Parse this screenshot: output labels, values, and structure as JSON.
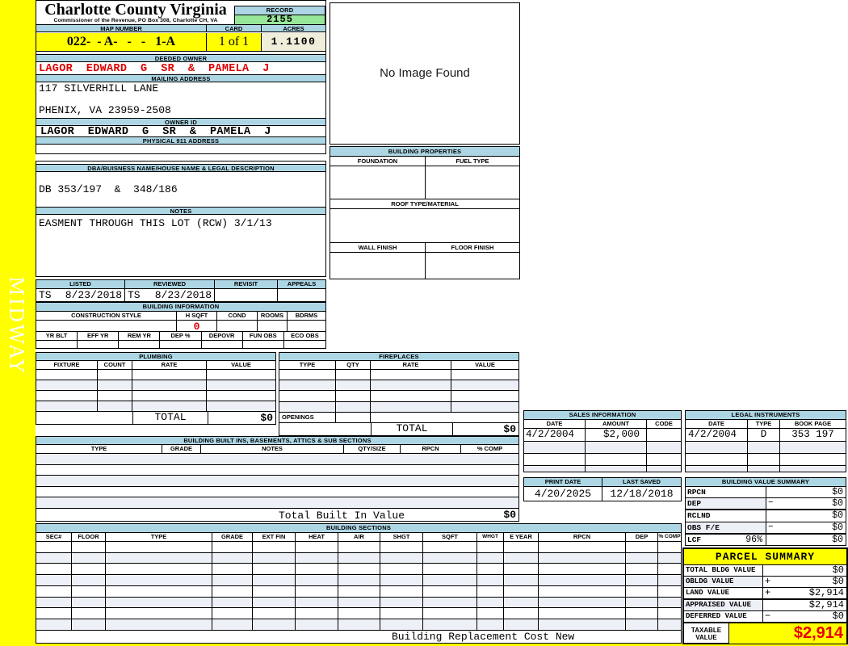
{
  "watermark": "MIDWAY",
  "colors": {
    "band_blue": "#ADD6E4",
    "record_green": "#98E798",
    "accent_yellow": "#FFFF00",
    "acres_cream": "#F0EDDB",
    "alert_red": "#DE0000"
  },
  "header": {
    "county": "Charlotte County Virginia",
    "commissioner": "Commissioner of the Revenue, PO Box 308, Charlotte CH, VA",
    "record_label": "RECORD",
    "record_value": "2155",
    "map_label": "MAP NUMBER",
    "map_value": "022-  - A-   -   -   1-A",
    "card_label": "CARD",
    "card_value": "1 of 1",
    "acres_label": "ACRES",
    "acres_value": "1.1100"
  },
  "owner": {
    "deeded_label": "DEEDED OWNER",
    "deeded_value": "LAGOR  EDWARD  G  SR  &  PAMELA  J",
    "mailing_label": "MAILING ADDRESS",
    "address_line1": "117 SILVERHILL LANE",
    "address_line2": "PHENIX, VA 23959-2508",
    "owner_id_label": "OWNER ID",
    "owner_id_value": "LAGOR  EDWARD  G  SR  &  PAMELA  J",
    "physical_label": "PHYSICAL 911 ADDRESS"
  },
  "photo": {
    "placeholder": "No Image Found"
  },
  "properties": {
    "title": "BUILDING PROPERTIES",
    "foundation_label": "FOUNDATION",
    "fuel_label": "FUEL TYPE",
    "roof_label": "ROOF TYPE/MATERIAL",
    "wall_label": "WALL FINISH",
    "floor_label": "FLOOR FINISH"
  },
  "dba": {
    "label": "DBA/BUISNESS NAME/HOUSE NAME & LEGAL DESCRIPTION",
    "value": "DB 353/197  &  348/186"
  },
  "notes": {
    "label": "NOTES",
    "value": "EASMENT THROUGH THIS LOT (RCW) 3/1/13"
  },
  "review": {
    "columns": [
      "LISTED",
      "REVIEWED",
      "REVISIT",
      "APPEALS"
    ],
    "listed_by": "TS",
    "listed_date": "8/23/2018",
    "reviewed_by": "TS",
    "reviewed_date": "8/23/2018"
  },
  "building_info": {
    "title": "BUILDING INFORMATION",
    "row1_columns": [
      "CONSTRUCTION STYLE",
      "H SQFT",
      "COND",
      "ROOMS",
      "BDRMS"
    ],
    "h_sqft": "0",
    "row2_columns": [
      "YR BLT",
      "EFF YR",
      "REM YR",
      "DEP %",
      "DEPOVR",
      "FUN OBS",
      "ECO OBS"
    ]
  },
  "plumbing": {
    "title": "PLUMBING",
    "columns": [
      "FIXTURE",
      "COUNT",
      "RATE",
      "VALUE"
    ],
    "total_label": "TOTAL",
    "total_value": "$0"
  },
  "fireplaces": {
    "title": "FIREPLACES",
    "columns": [
      "TYPE",
      "QTY",
      "RATE",
      "VALUE"
    ],
    "openings_label": "OPENINGS",
    "total_label": "TOTAL",
    "total_value": "$0"
  },
  "built_ins": {
    "title": "BUILDING BUILT INS, BASEMENTS, ATTICS & SUB SECTIONS",
    "columns": [
      "TYPE",
      "GRADE",
      "NOTES",
      "QTY/SIZE",
      "RPCN",
      "% COMP"
    ],
    "total_label": "Total Built In Value",
    "total_value": "$0"
  },
  "building_sections": {
    "title": "BUILDING SECTIONS",
    "columns": [
      "SEC#",
      "FLOOR",
      "TYPE",
      "GRADE",
      "EXT FIN",
      "HEAT",
      "AIR",
      "SHGT",
      "SQFT",
      "WHGT",
      "E YEAR",
      "RPCN",
      "DEP",
      "% COMP"
    ],
    "footer": "Building Replacement Cost New"
  },
  "sales": {
    "title": "SALES INFORMATION",
    "columns": [
      "DATE",
      "AMOUNT",
      "CODE"
    ],
    "rows": [
      {
        "date": "4/2/2004",
        "amount": "$2,000",
        "code": ""
      }
    ]
  },
  "legal": {
    "title": "LEGAL INSTRUMENTS",
    "columns": [
      "DATE",
      "TYPE",
      "BOOK PAGE"
    ],
    "rows": [
      {
        "date": "4/2/2004",
        "type": "D",
        "book_page": "353 197"
      }
    ]
  },
  "dates": {
    "print_label": "PRINT DATE",
    "print_value": "4/20/2025",
    "saved_label": "LAST SAVED",
    "saved_value": "12/18/2018"
  },
  "value_summary": {
    "title": "BUILDING VALUE SUMMARY",
    "rows": [
      {
        "label": "RPCN",
        "op": "",
        "value": "$0"
      },
      {
        "label": "DEP",
        "op": "−",
        "value": "$0"
      },
      {
        "label": "RCLND",
        "op": "",
        "value": "$0"
      },
      {
        "label": "OBS F/E",
        "op": "−",
        "value": "$0"
      },
      {
        "label": "LCF",
        "pct": "96%",
        "op": "",
        "value": "$0"
      }
    ]
  },
  "parcel": {
    "title": "PARCEL SUMMARY",
    "rows": [
      {
        "label": "TOTAL BLDG VALUE",
        "op": "",
        "value": "$0"
      },
      {
        "label": "OBLDG VALUE",
        "op": "+",
        "value": "$0"
      },
      {
        "label": "LAND VALUE",
        "op": "+",
        "value": "$2,914"
      },
      {
        "label": "APPRAISED VALUE",
        "op": "",
        "value": "$2,914"
      },
      {
        "label": "DEFERRED VALUE",
        "op": "−",
        "value": "$0"
      }
    ],
    "taxable_label": "TAXABLE VALUE",
    "taxable_value": "$2,914"
  }
}
